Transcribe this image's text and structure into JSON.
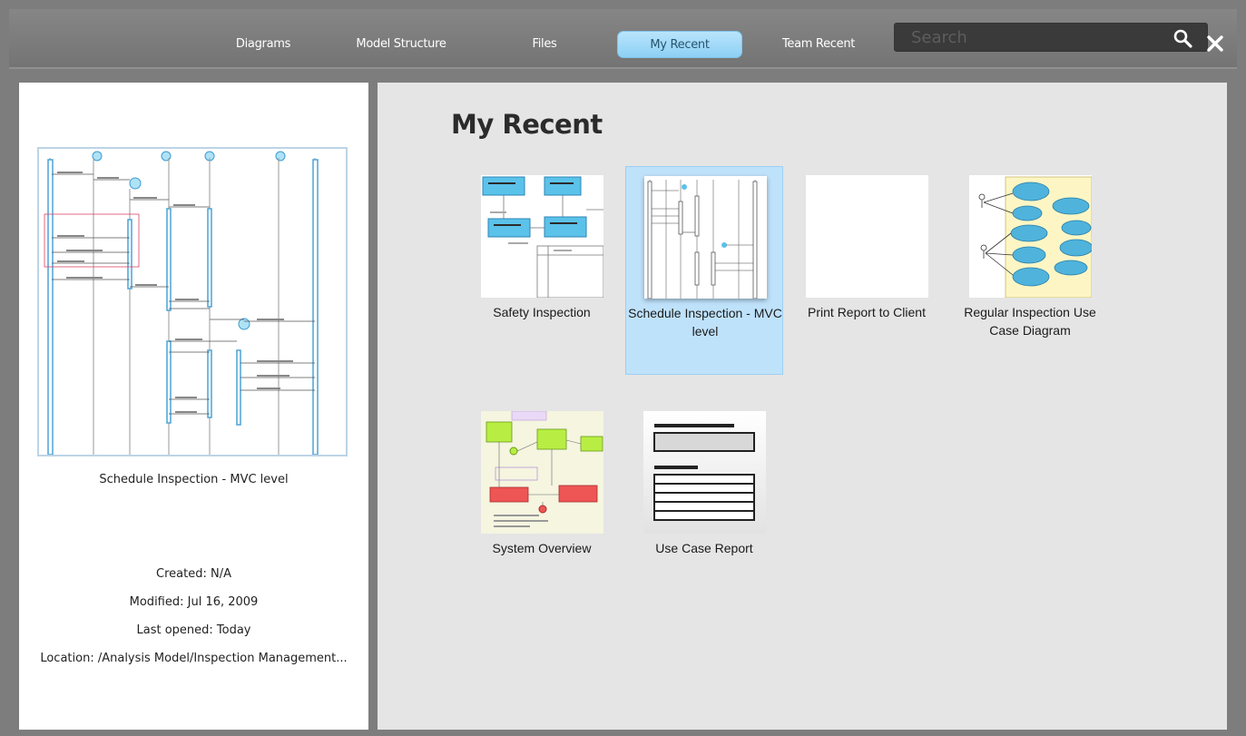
{
  "nav": {
    "tabs": [
      {
        "label": "Diagrams",
        "active": false
      },
      {
        "label": "Model Structure",
        "active": false
      },
      {
        "label": "Files",
        "active": false
      },
      {
        "label": "My Recent",
        "active": true
      },
      {
        "label": "Team Recent",
        "active": false
      }
    ],
    "search_placeholder": "Search",
    "search_value": ""
  },
  "details": {
    "title": "Schedule Inspection - MVC level",
    "created": "Created: N/A",
    "modified": "Modified: Jul 16, 2009",
    "last_opened": "Last opened: Today",
    "location": "Location: /Analysis Model/Inspection Management..."
  },
  "main": {
    "title": "My Recent",
    "items": [
      {
        "label": "Safety Inspection",
        "thumbnail": "class-diagram-thumbnail",
        "selected": false
      },
      {
        "label": "Schedule Inspection - MVC level",
        "thumbnail": "sequence-diagram-thumbnail",
        "selected": true
      },
      {
        "label": "Print Report to Client",
        "thumbnail": "blank-thumbnail",
        "selected": false
      },
      {
        "label": "Regular Inspection Use Case Diagram",
        "thumbnail": "use-case-diagram-thumbnail",
        "selected": false
      },
      {
        "label": "System Overview",
        "thumbnail": "overview-diagram-thumbnail",
        "selected": false
      },
      {
        "label": "Use Case Report",
        "thumbnail": "report-icon",
        "selected": false
      }
    ]
  },
  "colors": {
    "active_tab": "#bfe2fb",
    "selected_item": "#bfe2fb",
    "frame": "#7d7d7d",
    "main_bg": "#e5e5e5"
  }
}
